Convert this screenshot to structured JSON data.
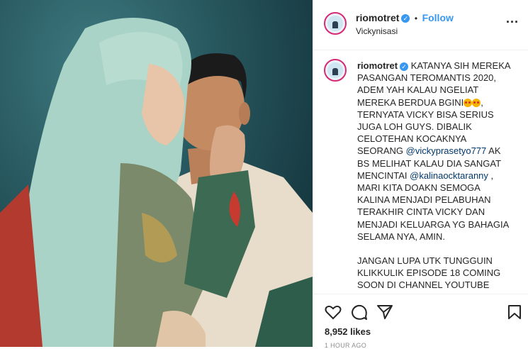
{
  "post": {
    "username": "riomotret",
    "follow_label": "Follow",
    "separator": "•",
    "location": "Vickynisasi",
    "more_label": "...",
    "caption_username": "riomotret",
    "caption_part1": "KATANYA SIH MEREKA PASANGAN TEROMANTIS 2020, ADEM YAH KALAU NGELIAT MEREKA BERDUA BGINI",
    "caption_part2": ", TERNYATA VICKY BISA SERIUS JUGA LOH GUYS. DIBALIK CELOTEHAN KOCAKNYA SEORANG ",
    "mention1": "@vickyprasetyo777",
    "caption_part3": " AK BS MELIHAT KALAU DIA SANGAT MENCINTAI ",
    "mention2": "@kalinaocktaranny",
    "caption_part4": " , MARI KITA DOAKN SEMOGA KALINA MENJADI PELABUHAN TERAKHIR CINTA VICKY DAN MENJADI KELUARGA YG BAHAGIA SELAMA NYA, AMIN.",
    "caption_part5": "JANGAN LUPA UTK TUNGGUIN KLIKKULIK EPISODE 18 COMING SOON DI CHANNEL YOUTUBE RIOMOTRET , KESERUAN PROSES FOTO PREWEDDING DENGAN KONSEP TER-UNIK YG PERNAH ADA",
    "likes": "8,952 likes",
    "timestamp": "1 HOUR AGO"
  },
  "icons": {
    "verified": "verified-badge-icon",
    "like": "heart-icon",
    "comment": "comment-icon",
    "share": "send-icon",
    "save": "bookmark-icon",
    "emoji": "heart-eyes-emoji-icon"
  },
  "colors": {
    "link": "#3897f0",
    "mention": "#00376b",
    "text": "#262626",
    "muted": "#8e8e8e",
    "photo_background": "#2a5b62"
  }
}
